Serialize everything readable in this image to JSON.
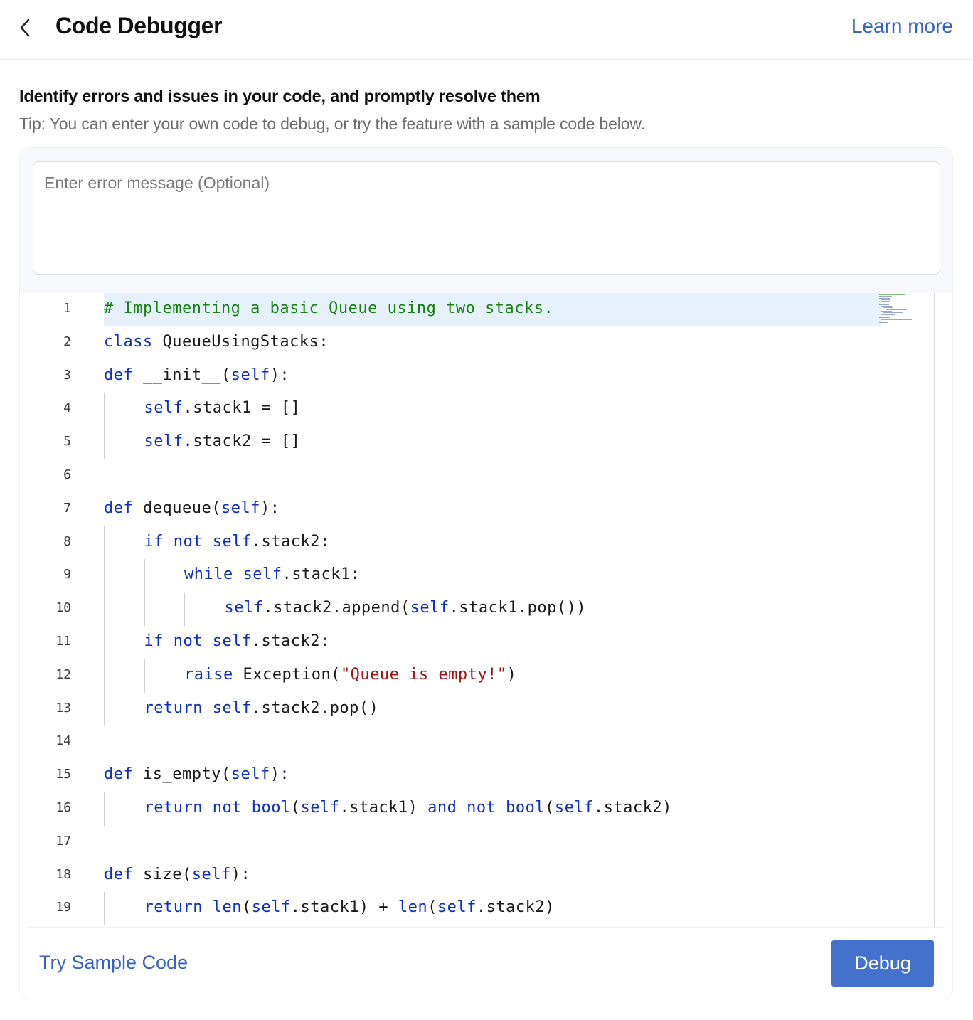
{
  "header": {
    "back_icon": "chevron-left-icon",
    "title": "Code Debugger",
    "learn_more": "Learn more"
  },
  "intro": {
    "subtitle": "Identify errors and issues in your code, and promptly resolve them",
    "tip": "Tip: You can enter your own code to debug, or try the feature with a sample code below."
  },
  "error_input": {
    "placeholder": "Enter error message (Optional)",
    "value": ""
  },
  "editor": {
    "active_line": 1,
    "lines": [
      {
        "n": "1",
        "indent": 0,
        "tokens": [
          {
            "t": "# Implementing a basic Queue using two stacks.",
            "c": "comment"
          }
        ]
      },
      {
        "n": "2",
        "indent": 0,
        "tokens": [
          {
            "t": "class",
            "c": "kw"
          },
          {
            "t": " QueueUsingStacks:",
            "c": ""
          }
        ]
      },
      {
        "n": "3",
        "indent": 0,
        "tokens": [
          {
            "t": "def",
            "c": "kw"
          },
          {
            "t": " __init__(",
            "c": ""
          },
          {
            "t": "self",
            "c": "kw"
          },
          {
            "t": "):",
            "c": ""
          }
        ]
      },
      {
        "n": "4",
        "indent": 1,
        "tokens": [
          {
            "t": "self",
            "c": "kw"
          },
          {
            "t": ".stack1 = []",
            "c": ""
          }
        ]
      },
      {
        "n": "5",
        "indent": 1,
        "tokens": [
          {
            "t": "self",
            "c": "kw"
          },
          {
            "t": ".stack2 = []",
            "c": ""
          }
        ]
      },
      {
        "n": "6",
        "indent": 0,
        "tokens": []
      },
      {
        "n": "7",
        "indent": 0,
        "tokens": [
          {
            "t": "def",
            "c": "kw"
          },
          {
            "t": " dequeue(",
            "c": ""
          },
          {
            "t": "self",
            "c": "kw"
          },
          {
            "t": "):",
            "c": ""
          }
        ]
      },
      {
        "n": "8",
        "indent": 1,
        "tokens": [
          {
            "t": "if",
            "c": "kw"
          },
          {
            "t": " ",
            "c": ""
          },
          {
            "t": "not",
            "c": "kw"
          },
          {
            "t": " ",
            "c": ""
          },
          {
            "t": "self",
            "c": "kw"
          },
          {
            "t": ".stack2:",
            "c": ""
          }
        ]
      },
      {
        "n": "9",
        "indent": 2,
        "tokens": [
          {
            "t": "while",
            "c": "kw"
          },
          {
            "t": " ",
            "c": ""
          },
          {
            "t": "self",
            "c": "kw"
          },
          {
            "t": ".stack1:",
            "c": ""
          }
        ]
      },
      {
        "n": "10",
        "indent": 3,
        "tokens": [
          {
            "t": "self",
            "c": "kw"
          },
          {
            "t": ".stack2.append(",
            "c": ""
          },
          {
            "t": "self",
            "c": "kw"
          },
          {
            "t": ".stack1.pop())",
            "c": ""
          }
        ]
      },
      {
        "n": "11",
        "indent": 1,
        "tokens": [
          {
            "t": "if",
            "c": "kw"
          },
          {
            "t": " ",
            "c": ""
          },
          {
            "t": "not",
            "c": "kw"
          },
          {
            "t": " ",
            "c": ""
          },
          {
            "t": "self",
            "c": "kw"
          },
          {
            "t": ".stack2:",
            "c": ""
          }
        ]
      },
      {
        "n": "12",
        "indent": 2,
        "tokens": [
          {
            "t": "raise",
            "c": "kw"
          },
          {
            "t": " Exception(",
            "c": ""
          },
          {
            "t": "\"Queue is empty!\"",
            "c": "str"
          },
          {
            "t": ")",
            "c": ""
          }
        ]
      },
      {
        "n": "13",
        "indent": 1,
        "tokens": [
          {
            "t": "return",
            "c": "kw"
          },
          {
            "t": " ",
            "c": ""
          },
          {
            "t": "self",
            "c": "kw"
          },
          {
            "t": ".stack2.pop()",
            "c": ""
          }
        ]
      },
      {
        "n": "14",
        "indent": 0,
        "tokens": []
      },
      {
        "n": "15",
        "indent": 0,
        "tokens": [
          {
            "t": "def",
            "c": "kw"
          },
          {
            "t": " is_empty(",
            "c": ""
          },
          {
            "t": "self",
            "c": "kw"
          },
          {
            "t": "):",
            "c": ""
          }
        ]
      },
      {
        "n": "16",
        "indent": 1,
        "tokens": [
          {
            "t": "return",
            "c": "kw"
          },
          {
            "t": " ",
            "c": ""
          },
          {
            "t": "not",
            "c": "kw"
          },
          {
            "t": " ",
            "c": ""
          },
          {
            "t": "bool",
            "c": "kw"
          },
          {
            "t": "(",
            "c": ""
          },
          {
            "t": "self",
            "c": "kw"
          },
          {
            "t": ".stack1) ",
            "c": ""
          },
          {
            "t": "and",
            "c": "kw"
          },
          {
            "t": " ",
            "c": ""
          },
          {
            "t": "not",
            "c": "kw"
          },
          {
            "t": " ",
            "c": ""
          },
          {
            "t": "bool",
            "c": "kw"
          },
          {
            "t": "(",
            "c": ""
          },
          {
            "t": "self",
            "c": "kw"
          },
          {
            "t": ".stack2)",
            "c": ""
          }
        ]
      },
      {
        "n": "17",
        "indent": 0,
        "tokens": []
      },
      {
        "n": "18",
        "indent": 0,
        "tokens": [
          {
            "t": "def",
            "c": "kw"
          },
          {
            "t": " size(",
            "c": ""
          },
          {
            "t": "self",
            "c": "kw"
          },
          {
            "t": "):",
            "c": ""
          }
        ]
      },
      {
        "n": "19",
        "indent": 1,
        "tokens": [
          {
            "t": "return",
            "c": "kw"
          },
          {
            "t": " ",
            "c": ""
          },
          {
            "t": "len",
            "c": "kw"
          },
          {
            "t": "(",
            "c": ""
          },
          {
            "t": "self",
            "c": "kw"
          },
          {
            "t": ".stack1) + ",
            "c": ""
          },
          {
            "t": "len",
            "c": "kw"
          },
          {
            "t": "(",
            "c": ""
          },
          {
            "t": "self",
            "c": "kw"
          },
          {
            "t": ".stack2)",
            "c": ""
          }
        ]
      }
    ]
  },
  "footer": {
    "try_sample": "Try Sample Code",
    "debug": "Debug"
  },
  "colors": {
    "accent": "#4471cc",
    "link": "#3563c4",
    "keyword": "#0b2fc7",
    "comment": "#16820f",
    "string": "#a31515",
    "active_line": "#e7f1fc"
  }
}
